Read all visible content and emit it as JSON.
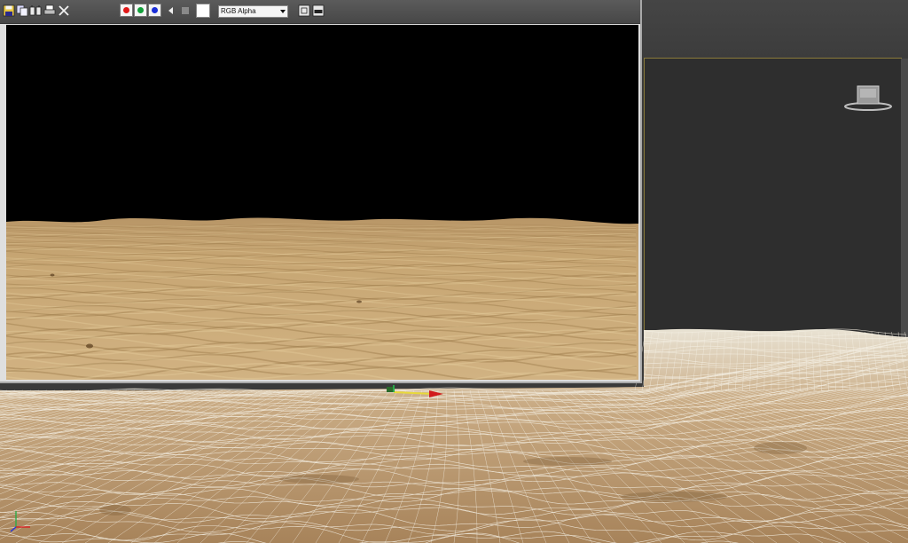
{
  "frame_window": {
    "toolbar": {
      "icons": [
        "save-image-icon",
        "copy-image-icon",
        "clone-window-icon",
        "print-icon",
        "clear-icon"
      ],
      "channels": [
        {
          "name": "red-channel",
          "color": "#e01818"
        },
        {
          "name": "green-channel",
          "color": "#12a03a"
        },
        {
          "name": "blue-channel",
          "color": "#1a2ed8"
        }
      ],
      "display_channel": "RGB Alpha",
      "swatch_color": "#ffffff"
    },
    "render": {
      "sky_color": "#000000",
      "sand_colors": [
        "#c9a671",
        "#b08a55",
        "#8e6c3e"
      ]
    }
  },
  "viewport": {
    "frame_border_color": "#8a7a3a",
    "wire_color": "#f4efe3",
    "terrain_colors": [
      "#b9956a",
      "#a1805a"
    ]
  }
}
